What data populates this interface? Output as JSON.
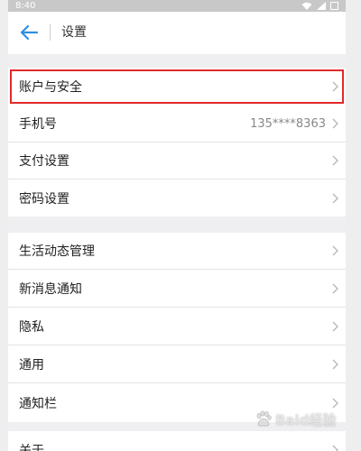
{
  "status_bar": {
    "time": "8:40"
  },
  "header": {
    "title": "设置"
  },
  "sections": [
    {
      "items": [
        {
          "label": "账户与安全",
          "highlighted": true
        }
      ]
    },
    {
      "items": [
        {
          "label": "手机号",
          "value": "135****8363"
        },
        {
          "label": "支付设置"
        },
        {
          "label": "密码设置"
        }
      ]
    },
    {
      "items": [
        {
          "label": "生活动态管理"
        },
        {
          "label": "新消息通知"
        },
        {
          "label": "隐私"
        },
        {
          "label": "通用"
        },
        {
          "label": "通知栏"
        }
      ]
    },
    {
      "items": [
        {
          "label": "关于"
        }
      ]
    }
  ],
  "watermark": {
    "text": "Baid经验"
  },
  "colors": {
    "highlight": "#e02a2a",
    "back_arrow": "#2f8fe3",
    "background": "#efeff2"
  }
}
